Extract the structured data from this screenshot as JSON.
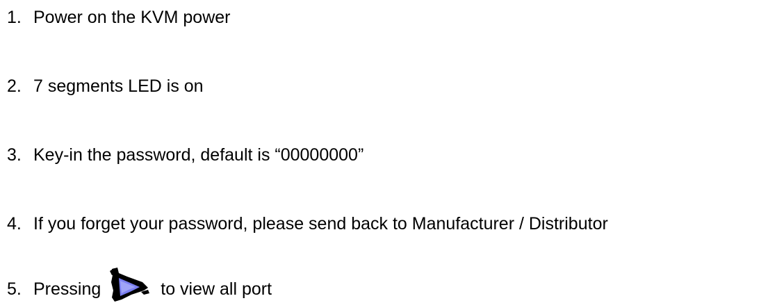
{
  "steps": [
    {
      "number": "1.",
      "text": "Power on the KVM power"
    },
    {
      "number": "2.",
      "text": "7 segments LED is on"
    },
    {
      "number": "3.",
      "text": "Key-in the password, default is “00000000”"
    },
    {
      "number": "4.",
      "text": "If you forget your password, please send back to Manufacturer / Distributor"
    },
    {
      "number": "5.",
      "text_before": "Pressing",
      "icon": "play-arrow-icon",
      "text_after": "to view all port"
    }
  ],
  "colors": {
    "text": "#000000",
    "icon_outline": "#000000",
    "icon_fill": "#7b7ff0"
  }
}
